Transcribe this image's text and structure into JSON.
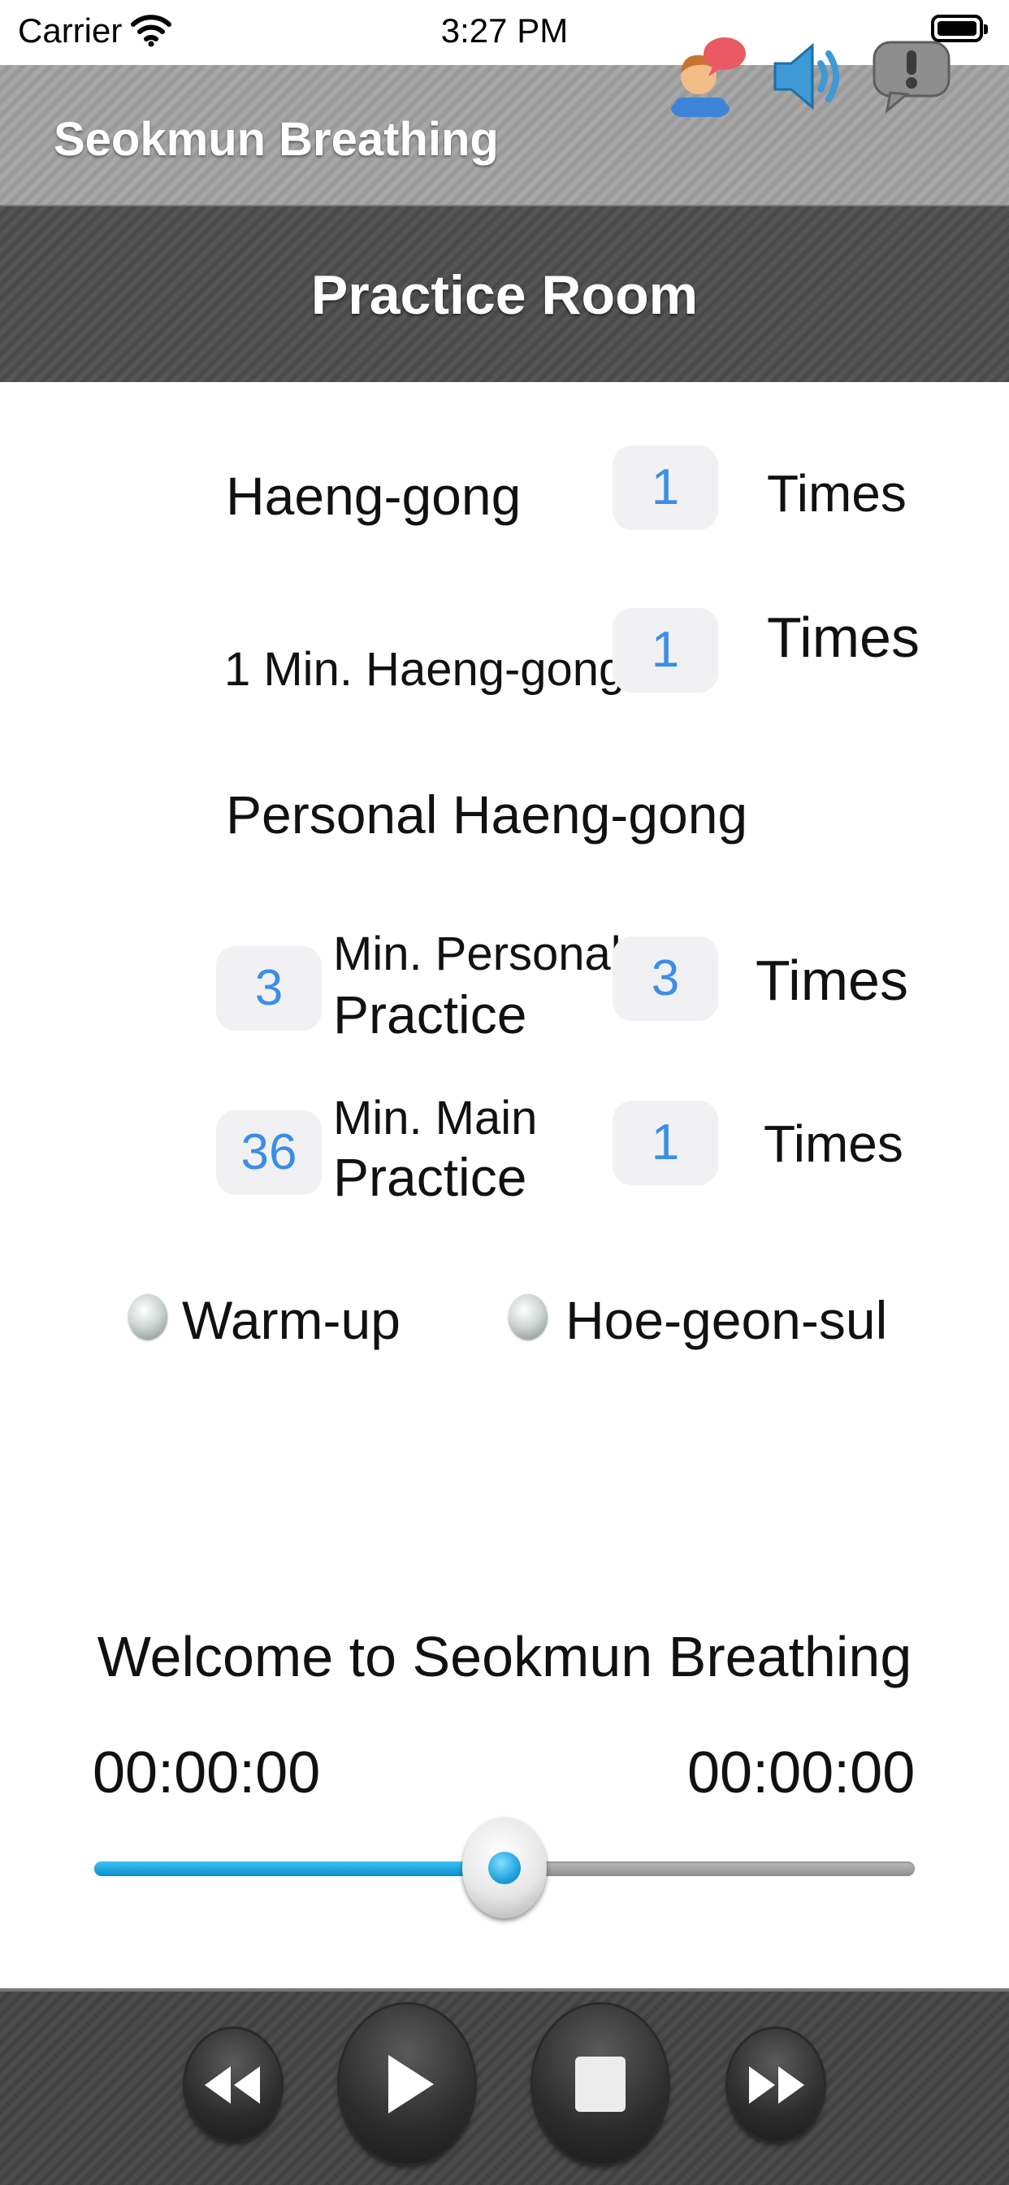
{
  "status_bar": {
    "carrier": "Carrier",
    "time": "3:27 PM"
  },
  "app_header": {
    "title": "Seokmun Breathing",
    "icons": [
      "profile-chat-icon",
      "speaker-icon",
      "alert-bubble-icon"
    ]
  },
  "title_bar": {
    "title": "Practice Room"
  },
  "practice": {
    "rows": [
      {
        "checked": true,
        "label": "Haeng-gong",
        "count": "1",
        "times_label": "Times"
      },
      {
        "checked": false,
        "label": "1 Min. Haeng-gong",
        "count": "1",
        "times_label": "Times"
      },
      {
        "checked": true,
        "label": "Personal Haeng-gong"
      },
      {
        "checked": false,
        "minutes": "3",
        "label_line1": "Min. Personal",
        "label_line2": "Practice",
        "count": "3",
        "times_label": "Times"
      },
      {
        "checked": true,
        "minutes": "36",
        "label_line1": "Min. Main",
        "label_line2": "Practice",
        "count": "1",
        "times_label": "Times"
      }
    ],
    "options": [
      {
        "label": "Warm-up",
        "selected": false
      },
      {
        "label": "Hoe-geon-sul",
        "selected": false
      }
    ]
  },
  "player": {
    "message": "Welcome to Seokmun Breathing",
    "elapsed": "00:00:00",
    "remaining": "00:00:00",
    "progress_fraction": 0.5,
    "controls": [
      "rewind",
      "play",
      "stop",
      "fast-forward"
    ]
  },
  "colors": {
    "accent_blue": "#3a8ee6",
    "checkbox_on": "#2a86ad",
    "slider_fill": "#16a6e4"
  }
}
